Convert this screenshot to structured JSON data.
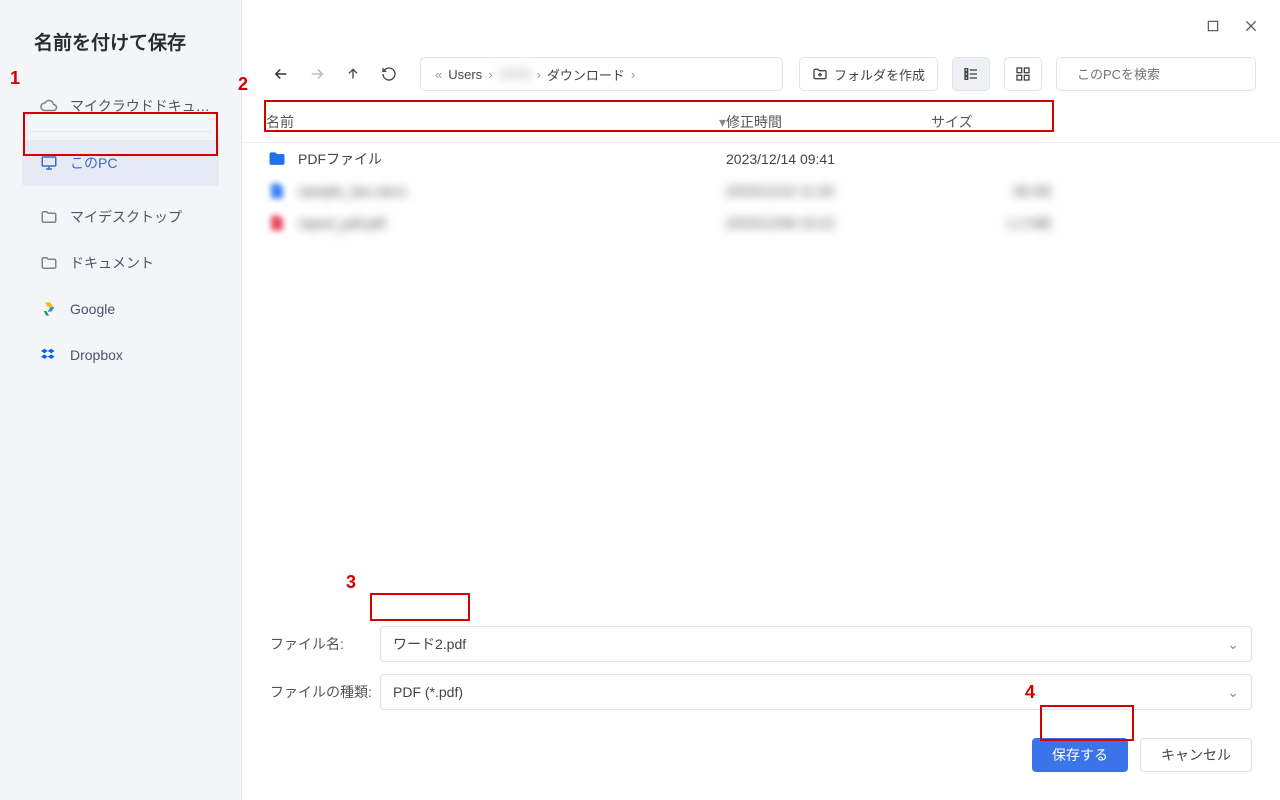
{
  "dialog_title": "名前を付けて保存",
  "sidebar": {
    "items": [
      {
        "id": "cloud",
        "label": "マイクラウドドキュ…"
      },
      {
        "id": "thispc",
        "label": "このPC"
      },
      {
        "id": "desktop",
        "label": "マイデスクトップ"
      },
      {
        "id": "docs",
        "label": "ドキュメント"
      },
      {
        "id": "google",
        "label": "Google"
      },
      {
        "id": "dropbox",
        "label": "Dropbox"
      }
    ]
  },
  "breadcrumb": {
    "parts": [
      "Users",
      "",
      "ダウンロード"
    ]
  },
  "newfolder_label": "フォルダを作成",
  "search_placeholder": "このPCを検索",
  "columns": {
    "name": "名前",
    "mod": "修正時間",
    "size": "サイズ"
  },
  "files": [
    {
      "name": "PDFファイル",
      "mod": "2023/12/14 09:41",
      "size": "",
      "type": "folder"
    },
    {
      "name": "sample_doc.docx",
      "mod": "2023/12/10 11:30",
      "size": "48 KB",
      "type": "file",
      "blurred": true
    },
    {
      "name": "report_pdf.pdf",
      "mod": "2023/12/08 15:22",
      "size": "1.2 MB",
      "type": "file",
      "blurred": true
    }
  ],
  "filename_label": "ファイル名:",
  "filetype_label": "ファイルの種類:",
  "filename_value": "ワード2.pdf",
  "filetype_value": "PDF (*.pdf)",
  "save_label": "保存する",
  "cancel_label": "キャンセル",
  "annotations": {
    "n1": "1",
    "n2": "2",
    "n3": "3",
    "n4": "4"
  }
}
